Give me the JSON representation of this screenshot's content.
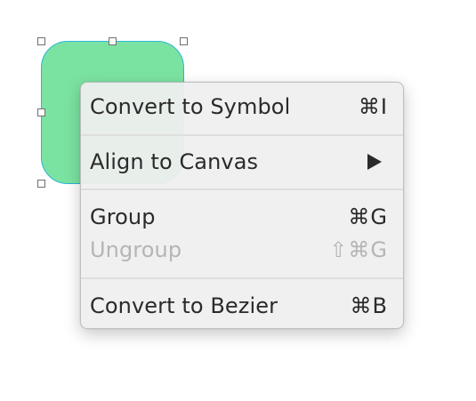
{
  "canvas": {
    "shape_fill": "#7be3a2",
    "shape_stroke": "#29b6d9",
    "handle_icon": "square-handle"
  },
  "context_menu": {
    "items": [
      {
        "label": "Convert to Symbol",
        "shortcut": "⌘I",
        "enabled": true
      },
      {
        "label": "Align to Canvas",
        "submenu_icon": "triangle-right-icon",
        "enabled": true
      },
      {
        "label": "Group",
        "shortcut": "⌘G",
        "enabled": true
      },
      {
        "label": "Ungroup",
        "shortcut": "⇧⌘G",
        "enabled": false
      },
      {
        "label": "Convert to Bezier",
        "shortcut": "⌘B",
        "enabled": true
      }
    ],
    "text_color": "#2a2a2a",
    "disabled_color": "#b5b5b5"
  }
}
